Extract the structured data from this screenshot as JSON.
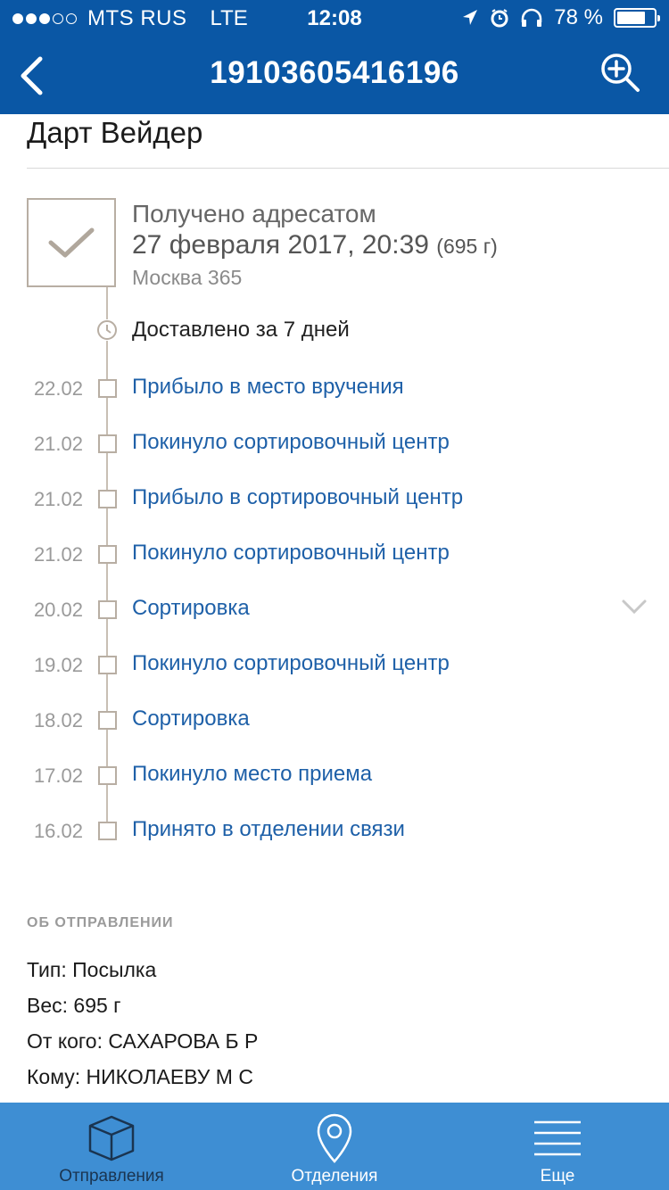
{
  "status_bar": {
    "carrier": "MTS RUS",
    "network": "LTE",
    "time": "12:08",
    "battery_percent": "78 %",
    "battery_level": 0.78,
    "signal_bars_filled": 3,
    "signal_bars_total": 5
  },
  "nav": {
    "title": "19103605416196",
    "back_icon": "chevron-left-icon",
    "zoom_icon": "zoom-in-icon"
  },
  "shipment": {
    "recipient_name": "Дарт Вейдер",
    "current_status": {
      "title": "Получено адресатом",
      "datetime": "27 февраля 2017, 20:39",
      "weight": "(695 г)",
      "place": "Москва 365"
    },
    "delivered_in": "Доставлено за 7 дней",
    "events": [
      {
        "date": "22.02",
        "text": "Прибыло в место вручения"
      },
      {
        "date": "21.02",
        "text": "Покинуло сортировочный центр"
      },
      {
        "date": "21.02",
        "text": "Прибыло в сортировочный центр"
      },
      {
        "date": "21.02",
        "text": "Покинуло сортировочный центр"
      },
      {
        "date": "20.02",
        "text": "Сортировка"
      },
      {
        "date": "19.02",
        "text": "Покинуло сортировочный центр"
      },
      {
        "date": "18.02",
        "text": "Сортировка"
      },
      {
        "date": "17.02",
        "text": "Покинуло место приема"
      },
      {
        "date": "16.02",
        "text": "Принято в отделении связи"
      }
    ]
  },
  "about": {
    "section_title": "ОБ ОТПРАВЛЕНИИ",
    "type": "Тип: Посылка",
    "weight": "Вес: 695 г",
    "from": "От кого: САХАРОВА Б Р",
    "to": "Кому: НИКОЛАЕВУ М С"
  },
  "tabbar": {
    "tabs": [
      {
        "label": "Отправления",
        "icon": "box-icon"
      },
      {
        "label": "Отделения",
        "icon": "location-pin-icon"
      },
      {
        "label": "Еще",
        "icon": "menu-icon"
      }
    ]
  },
  "colors": {
    "header_bg": "#0a57a5",
    "tabbar_bg": "#3e8ed3",
    "link": "#1e60a8",
    "timeline": "#b8aea3"
  }
}
